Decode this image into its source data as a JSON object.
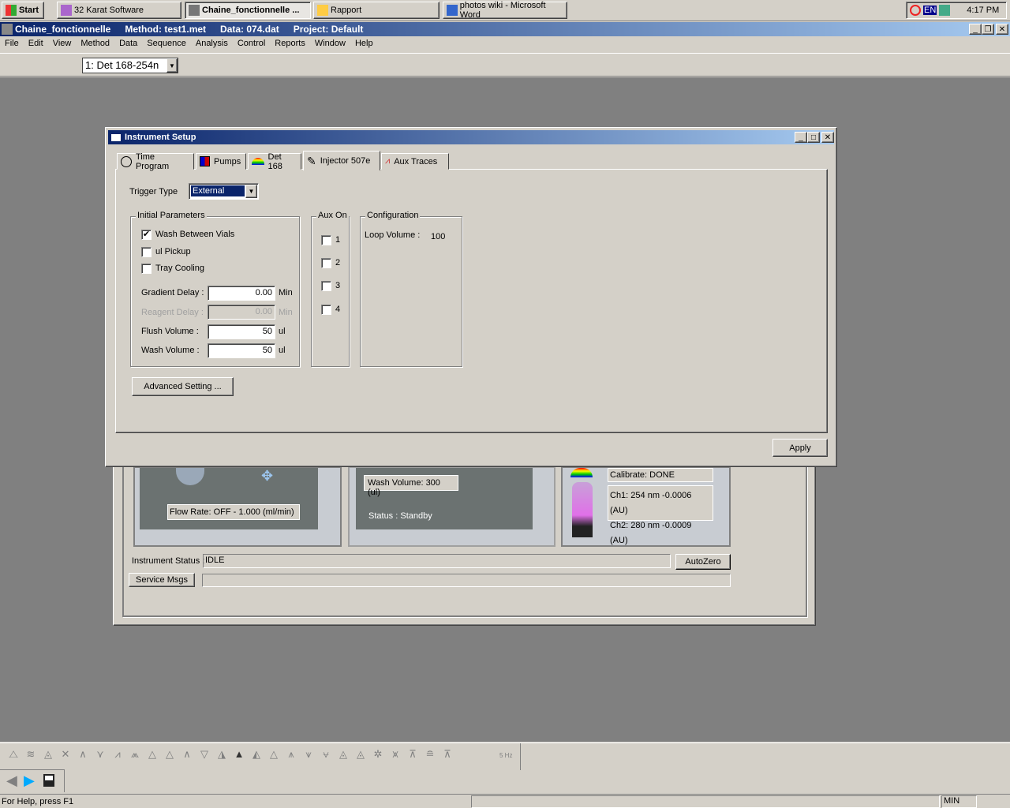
{
  "taskbar": {
    "start": "Start",
    "items": [
      "32 Karat Software",
      "Chaine_fonctionnelle ...",
      "Rapport",
      "photos wiki - Microsoft Word"
    ],
    "lang": "EN",
    "clock": "4:17 PM"
  },
  "titlebar": {
    "app": "Chaine_fonctionnelle",
    "method": "Method: test1.met",
    "data": "Data: 074.dat",
    "project": "Project: Default"
  },
  "menu": [
    "File",
    "Edit",
    "View",
    "Method",
    "Data",
    "Sequence",
    "Analysis",
    "Control",
    "Reports",
    "Window",
    "Help"
  ],
  "toolbar": {
    "detector_select": "1: Det 168-254n"
  },
  "dialog": {
    "title": "Instrument Setup",
    "tabs": [
      "Time Program",
      "Pumps",
      "Det 168",
      "Injector 507e",
      "Aux Traces"
    ],
    "active_tab": "Injector 507e",
    "trigger_label": "Trigger Type",
    "trigger_value": "External",
    "initial": {
      "title": "Initial Parameters",
      "checks": [
        {
          "label": "Wash Between Vials",
          "checked": true
        },
        {
          "label": "ul Pickup",
          "checked": false
        },
        {
          "label": "Tray Cooling",
          "checked": false
        }
      ],
      "fields": [
        {
          "label": "Gradient Delay :",
          "value": "0.00",
          "unit": "Min",
          "disabled": false
        },
        {
          "label": "Reagent Delay :",
          "value": "0.00",
          "unit": "Min",
          "disabled": true
        },
        {
          "label": "Flush Volume :",
          "value": "50",
          "unit": "ul",
          "disabled": false
        },
        {
          "label": "Wash Volume :",
          "value": "50",
          "unit": "ul",
          "disabled": false
        }
      ]
    },
    "aux": {
      "title": "Aux On",
      "items": [
        "1",
        "2",
        "3",
        "4"
      ]
    },
    "config": {
      "title": "Configuration",
      "loop_label": "Loop Volume :",
      "loop_value": "100"
    },
    "advanced": "Advanced Setting ...",
    "apply": "Apply"
  },
  "status_window": {
    "flow_rate": "Flow Rate: OFF - 1.000 (ml/min)",
    "wash_volume": "Wash Volume: 300 (ul)",
    "injector_status": "Status : Standby",
    "calibrate": "Calibrate: DONE",
    "ch1": "Ch1: 254 nm  -0.0006 (AU)",
    "ch2": "Ch2: 280 nm  -0.0009 (AU)",
    "instrument_status_label": "Instrument Status :",
    "instrument_status": "IDLE",
    "autozero": "AutoZero",
    "service": "Service Msgs"
  },
  "peak_toolbar": {
    "last": "5 Hz"
  },
  "statusbar": {
    "help": "For Help, press F1",
    "mode": "MIN"
  }
}
